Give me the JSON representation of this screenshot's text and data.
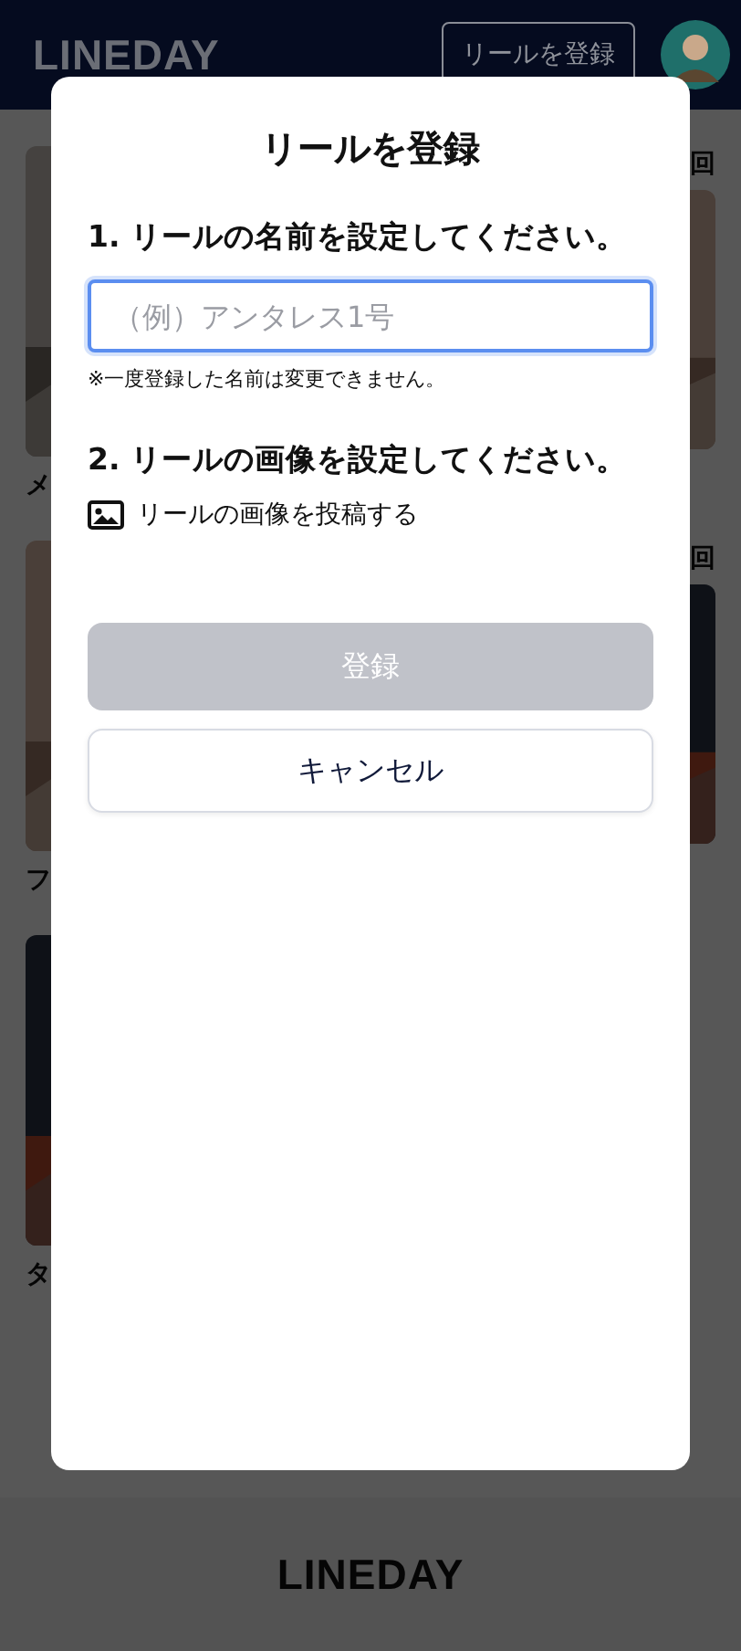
{
  "header": {
    "logo": "LINEDAY",
    "register_button": "リールを登録"
  },
  "feed": {
    "left": [
      {
        "title": "メ"
      },
      {
        "title": "フ"
      },
      {
        "title": "タ"
      }
    ],
    "right": [
      {
        "title": "回"
      },
      {
        "title": "回"
      }
    ]
  },
  "modal": {
    "title": "リールを登録",
    "name_heading": "1. リールの名前を設定してください。",
    "name_input": {
      "placeholder": "（例）アンタレス1号",
      "focused": true
    },
    "note": "※一度登録した名前は変更できません。",
    "image_heading": "2. リールの画像を設定してください。",
    "image_upload": "リールの画像を投稿する",
    "submit": {
      "label": "登録",
      "disabled": true
    },
    "cancel": "キャンセル"
  },
  "footer": {
    "logo": "LINEDAY"
  }
}
